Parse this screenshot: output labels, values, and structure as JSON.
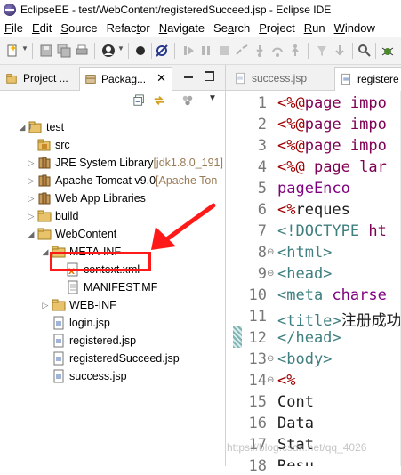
{
  "window": {
    "title": "EclipseEE - test/WebContent/registeredSucceed.jsp - Eclipse IDE"
  },
  "menu": [
    {
      "label": "File",
      "u": "F"
    },
    {
      "label": "Edit",
      "u": "E"
    },
    {
      "label": "Source",
      "u": "S"
    },
    {
      "label": "Refactor",
      "u": "t"
    },
    {
      "label": "Navigate",
      "u": "N"
    },
    {
      "label": "Search",
      "u": "a"
    },
    {
      "label": "Project",
      "u": "P"
    },
    {
      "label": "Run",
      "u": "R"
    },
    {
      "label": "Window",
      "u": "W"
    }
  ],
  "left_panel": {
    "tabs": [
      {
        "label": "Project ...",
        "icon": "project-explorer-icon"
      },
      {
        "label": "Packag...",
        "icon": "package-explorer-icon"
      }
    ],
    "tree": [
      {
        "label": "test",
        "level": 0,
        "arrow": "expanded",
        "icon": "project"
      },
      {
        "label": "src",
        "level": 1,
        "arrow": "none",
        "icon": "src-folder"
      },
      {
        "label": "JRE System Library",
        "suffix": " [jdk1.8.0_191]",
        "level": 1,
        "arrow": "collapsed",
        "icon": "library"
      },
      {
        "label": "Apache Tomcat v9.0",
        "suffix": " [Apache Ton",
        "level": 1,
        "arrow": "collapsed",
        "icon": "library"
      },
      {
        "label": "Web App Libraries",
        "level": 1,
        "arrow": "collapsed",
        "icon": "library"
      },
      {
        "label": "build",
        "level": 1,
        "arrow": "collapsed",
        "icon": "folder"
      },
      {
        "label": "WebContent",
        "level": 1,
        "arrow": "expanded",
        "icon": "folder"
      },
      {
        "label": "META-INF",
        "level": 2,
        "arrow": "expanded",
        "icon": "folder"
      },
      {
        "label": "context.xml",
        "level": 3,
        "arrow": "none",
        "icon": "xml-file"
      },
      {
        "label": "MANIFEST.MF",
        "level": 3,
        "arrow": "none",
        "icon": "file"
      },
      {
        "label": "WEB-INF",
        "level": 2,
        "arrow": "collapsed",
        "icon": "folder"
      },
      {
        "label": "login.jsp",
        "level": 2,
        "arrow": "none",
        "icon": "jsp-file"
      },
      {
        "label": "registered.jsp",
        "level": 2,
        "arrow": "none",
        "icon": "jsp-file"
      },
      {
        "label": "registeredSucceed.jsp",
        "level": 2,
        "arrow": "none",
        "icon": "jsp-file"
      },
      {
        "label": "success.jsp",
        "level": 2,
        "arrow": "none",
        "icon": "jsp-file"
      }
    ]
  },
  "editor": {
    "tabs": [
      {
        "label": "success.jsp",
        "active": false
      },
      {
        "label": "registere",
        "active": true
      }
    ],
    "lines": [
      {
        "n": "1",
        "fold": "",
        "text": "<%@page impo"
      },
      {
        "n": "2",
        "fold": "",
        "text": "<%@page impo"
      },
      {
        "n": "3",
        "fold": "",
        "text": "<%@page impo"
      },
      {
        "n": "4",
        "fold": "",
        "text": "<%@ page lar"
      },
      {
        "n": "5",
        "fold": "",
        "text": "    pageEnco"
      },
      {
        "n": "6",
        "fold": "",
        "text": "    <%reques"
      },
      {
        "n": "7",
        "fold": "",
        "text": "<!DOCTYPE ht"
      },
      {
        "n": "8",
        "fold": "⊖",
        "text": "<html>"
      },
      {
        "n": "9",
        "fold": "⊖",
        "text": "<head>"
      },
      {
        "n": "10",
        "fold": "",
        "text": "<meta charse"
      },
      {
        "n": "11",
        "fold": "",
        "text": "<title>注册成功"
      },
      {
        "n": "12",
        "fold": "",
        "text": "</head>"
      },
      {
        "n": "13",
        "fold": "⊖",
        "text": "<body>"
      },
      {
        "n": "14",
        "fold": "⊖",
        "text": "<%"
      },
      {
        "n": "15",
        "fold": "",
        "text": "        Cont"
      },
      {
        "n": "16",
        "fold": "",
        "text": "        Data"
      },
      {
        "n": "17",
        "fold": "",
        "text": "        Stat"
      },
      {
        "n": "18",
        "fold": "",
        "text": "        Resu"
      }
    ]
  },
  "watermark": "https://blog.csdn.net/qq_4026"
}
